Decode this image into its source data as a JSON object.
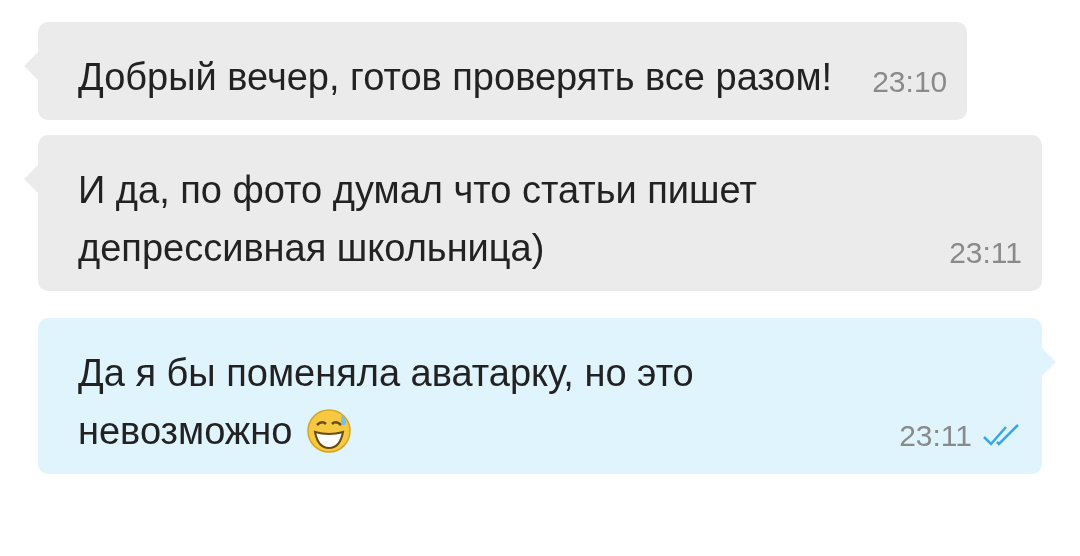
{
  "messages": [
    {
      "kind": "incoming",
      "lines": [
        "Добрый вечер, готов проверять все разом!"
      ],
      "time": "23:10",
      "has_emoji": false
    },
    {
      "kind": "incoming",
      "lines": [
        "И да, по фото думал что статьи пишет",
        "депрессивная школьница)"
      ],
      "time": "23:11",
      "has_emoji": false
    },
    {
      "kind": "outgoing",
      "lines": [
        "Да я бы поменяла аватарку, но это",
        "невозможно"
      ],
      "time": "23:11",
      "has_emoji": true,
      "read": true
    }
  ]
}
